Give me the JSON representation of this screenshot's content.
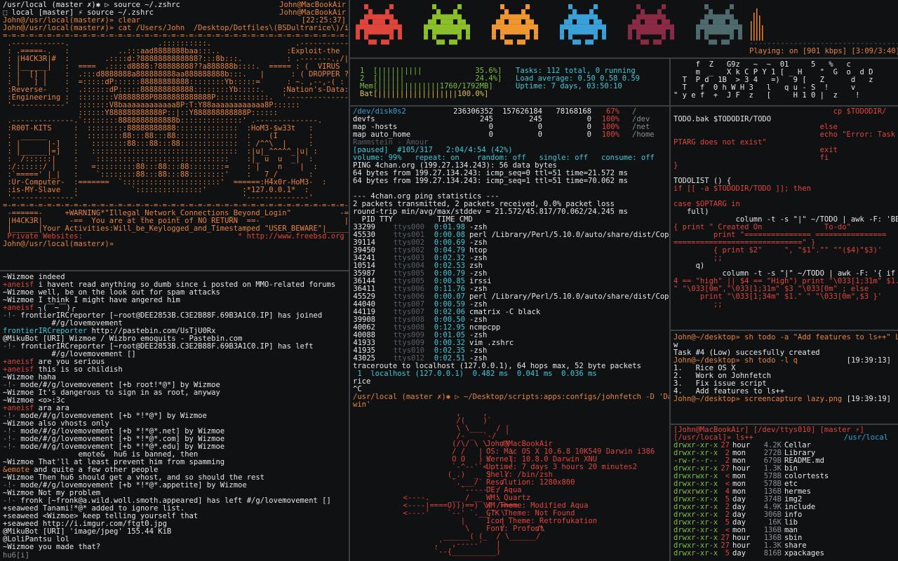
{
  "colors": {
    "red": "#e0453b",
    "green": "#8bbf2a",
    "orange": "#f0962e",
    "blue": "#3aa0d8",
    "maroon": "#8a2a45",
    "slate": "#4f6a6c"
  },
  "tl": {
    "lines": [
      "/usr/local (master ✗)✱ ▷ source ~/.zshrc",
      "⬚ local [master] ⚡ source ~/.zshrc",
      "John@/usr/local(master✗)» clear",
      "John@/usr/local(master✗)» cat /Users/John  /Desktop/Dotfiles\\(BSDultrarice\\)/issue"
    ],
    "right": [
      "John@MacBookAir",
      "John@MacBookAir",
      "[22:25:37]",
      ""
    ],
    "art": [
      "=-=-=-=-=-=-=-=-=-=-=-=-=-=-=-=-=-=-=-=-=-=-=-=-=-=-=-=-=-=-=-=-=-=-=-=-=-=-=-=-=-=-=-=-=",
      " .------------.                    .::::::::::.                   .--------------.",
      " : .=====-.   :           ..:::aad8888888baa:::..               :Exploit-the   :",
      " : |H4CK3R|#  :        .::::d:?8888888888888?:::8b:::.          : .-------.,/| :",
      " : |______|   :  ====  .::::d8888:?88888888??a888888b::::.  ===== : (  VIRUS  / :",
      " : |  [] |    :  .:::d8888888a888888888aa888888888b:::.   |      : ( DROPPER ? :",
      " : |   ] |    :  =:::::dP::::::88888888888::::::::Yb:::::=      : ~. ,--,-( :",
      " :Reverse-    :  .::::::dP:::::888888888888::::::::Yb:::::.    :Nation's-Data:",
      " :Engineering :  ::::::::V8888888P8888888888888P::::::::::::.  '--------------'",
      " '------------'  :::::::V8baaaaaaaaaaaa8P:T:Y88aaaaaaaaaaaa8P::::::",
      "                 ::::::Y888888888888P::|::Y888888888888P::::::",
      " .--------------.`::::::::8888888888888b::::::::::::::' .--------------.",
      " :R00T-KITS     :  :::::::::88888888888::::::::::::::  :HoM3-$w33t   :",
      " :  ______      :  ::::::::88:::88:::88::::::::::::::  :    (I       :",
      " : |      |-]   :   ::::::::88:::88:::88:::::::::::::  : /^^\\  |     :",
      " : |______|=]   :   :::::::::::::::::::::::::::::::::  :|u|_^^^^^_|u| :",
      " :  /::::::|    :    ::::::::::::::::::::::::::::::    :|_ u  u  _|  :",
      " :/::::::/ |    :   =:::::::::88:::88:::88::::::::=    : |    n    |  :",
      " :`=====' |_|   :    `::::::::88:::88:::88::::::::'    :   7_/       :",
      " :Ur-Computer-  :=======  `::::::::::::::::::::::'  ======:H4x0r-HoM3-  :",
      " :is-MY-Slave   :            `:::::::::::::::'        :*127.0.0.1*  :",
      " '--------------'                                     '--------------'",
      "=-=-=-=-=-=-=-=-=-=-=-=-=-=-=-=-=-=-=-=-=-=-=-=-=-=-=-=-=-=-=-=-=-=-=-=-=-=-=-=-=-=-=-=-="
    ],
    "banner": [
      " -======-     +WARNING*\"Illegal_Network_Connections_Beyond_Login\"           -======-",
      " |H4CK3R|      -==  You are at the point of NO RETURN  ==-                   |H4CK3R|",
      " |______|Your Activities:Will_be_Keylogged_and_Timestamped \"USER_BEWARE\"|______|",
      " Private Websites:                                   * http://www.freebsd.org"
    ],
    "prompt": "John@/usr/local(master✗)»"
  },
  "irc": {
    "lines": [
      [
        "~Wizmoe",
        "indeed"
      ],
      [
        "+aneisf",
        "i havent read anything so dumb since i posted on MMO-related forums"
      ],
      [
        "~Wizmoe",
        "well, be on the look out for spam attacks"
      ],
      [
        "~Wizmoe",
        "I think I might have angered him"
      ],
      [
        "+aneisf",
        "╮(￣~￣)╭"
      ],
      [
        "-!-",
        "frontierIRCreporter [~root@DEE2853B.C3E2B88F.69B3A1C0.IP] has joined"
      ],
      [
        "",
        "          #/g/lovemovement"
      ],
      [
        "frontierIRCreporter",
        "http://pastebin.com/UsTjU0Rx"
      ],
      [
        "@MikuBot",
        "[URI] Wizmoe / Wizbro emoquits - Pastebin.com"
      ],
      [
        "-!-",
        "frontierIRCreporter [~root@DEE2853B.C3E2B88F.69B3A1C0.IP] has left"
      ],
      [
        "",
        "          #/g/lovemovement []"
      ],
      [
        "+aneisf",
        "are you serious"
      ],
      [
        "+aneisf",
        "this is so childish"
      ],
      [
        "~Wizmoe",
        "haha"
      ],
      [
        "-!-",
        "mode/#/g/lovemovement [+b root!*@*] by Wizmoe"
      ],
      [
        "~Wizmoe",
        "It's dangerous to sign in as root, anyway"
      ],
      [
        "~Wizmoe",
        "<o>:3c"
      ],
      [
        "+aneisf",
        "ara ara"
      ],
      [
        "-!-",
        "mode/#/g/lovemovement [+b *!*@*] by Wizmoe"
      ],
      [
        "~Wizmoe",
        "also vhosts only"
      ],
      [
        "-!-",
        "mode/#/g/lovemovement [+b *!*@*.net] by Wizmoe"
      ],
      [
        "-!-",
        "mode/#/g/lovemovement [+b *!*@*.com] by Wizmoe"
      ],
      [
        "-!-",
        "mode/#/g/lovemovement [+b *!*@*.edu] by Wizmoe"
      ],
      [
        "",
        "                emote&  hu6 is banned, then"
      ],
      [
        "~Wizmoe",
        "That'll at least prevent him from spamming"
      ],
      [
        "&emote",
        "and quite a few other people"
      ],
      [
        "~Wizmoe",
        "Then hu6 should get a vhost, and so should the rest"
      ],
      [
        "-!-",
        "mode/#/g/lovemovement [+b *!*@*.appetite] by Wizmoe"
      ],
      [
        "~Wizmoe",
        "Not my problem"
      ],
      [
        "-!-",
        "fronk [~fronk@a.wild.woll.smoth.appeared] has left #/g/lovemovement []"
      ],
      [
        "+seaweed",
        "Tanami!*@* added to ignore list."
      ],
      [
        "+seaweed",
        "<Wizmoe> keep telling yourself that"
      ],
      [
        "+seaweed",
        "http://i.imgur.com/ftgt0.jpg"
      ],
      [
        "@MikuBot",
        "[URI] 'image/jpeg' 155.44 KiB"
      ],
      [
        "@LoliPantsu",
        "lol"
      ],
      [
        "~Wizmoe",
        "you made that?"
      ]
    ],
    "input": "hu6[i]"
  },
  "top_right": {
    "music": "Playing: on [901 kbps] [3:09/3:40]",
    "dashes": "-------------------------------------___"
  },
  "htop": {
    "cpu1": "1  [||||||||||            35.6%]",
    "cpu2": "2  [||||||                24.4%]",
    "mem": "Mem[||||||||||||||1760/1792MB]",
    "bat": "Bat[||||||||||||||||||100.0%]",
    "tasks": "Tasks: 112 total, 0 running",
    "load": "Load average: 0.50 0.58 0.59",
    "uptime": "Uptime: 7 days, 03:50:10"
  },
  "matrix": [
    "     f  Z   G9z   ~  ~  01     5   %   c",
    "     m  _   X k C P Y 1 [ _ H    \"  G  o  d D",
    "  T  P d  1B  > 3 4   =)   9 [   Z      d   z",
    "  T   f  0 h W H 3   l   q u - S  !     v",
    "\" y e f  +  J F  z   [     H 1 0 |  z    !"
  ],
  "df": {
    "rows": [
      [
        "/dev/disk0s2",
        "236306352",
        "157626184",
        "78168168",
        "67%",
        "/"
      ],
      [
        "devfs",
        "245",
        "245",
        "0",
        "100%",
        "/dev"
      ],
      [
        "map -hosts",
        "0",
        "0",
        "0",
        "100%",
        "/net"
      ],
      [
        "map auto_home",
        "0",
        "0",
        "0",
        "100%",
        "/home"
      ]
    ],
    "song": "Rammstein - Amour",
    "paused": "[paused]  #105/317   2:04/4:54 (42%)",
    "opts": "volume: 99%   repeat: on    random: off   single: off   consume: off"
  },
  "ping": [
    "PING 4chan.org (199.27.134.243): 56 data bytes",
    "64 bytes from 199.27.134.243: icmp_seq=0 ttl=51 time=21.572 ms",
    "64 bytes from 199.27.134.243: icmp_seq=1 ttl=51 time=70.062 ms",
    "",
    "--- 4chan.org ping statistics ---",
    "2 packets transmitted, 2 packets received, 0.0% packet loss",
    "round-trip min/avg/max/stddev = 21.572/45.817/70.062/24.245 ms"
  ],
  "ps": {
    "header": "  PID TTY          TIME CMD",
    "rows": [
      [
        "33299",
        "ttys000",
        "0:01.98",
        "-zsh"
      ],
      [
        "45530",
        "ttys001",
        "0:00.08",
        "perl /Library/Perl/5.10.0/auto/share/dist/Cope/p"
      ],
      [
        "39114",
        "ttys002",
        "0:00.69",
        "-zsh"
      ],
      [
        "39450",
        "ttys002",
        "0:04.79",
        "htop"
      ],
      [
        "34241",
        "ttys003",
        "0:02.32",
        "-zsh"
      ],
      [
        "10514",
        "ttys004",
        "0:02.53",
        "zsh"
      ],
      [
        "35987",
        "ttys005",
        "0:00.79",
        "-zsh"
      ],
      [
        "36144",
        "ttys005",
        "0:00.85",
        "irssi"
      ],
      [
        "36411",
        "ttys006",
        "0:11.76",
        "-zsh"
      ],
      [
        "45529",
        "ttys006",
        "0:00.07",
        "perl /Library/Perl/5.10.0/auto/share/dist/Cope//"
      ],
      [
        "44040",
        "ttys007",
        "0:00.59",
        "-zsh"
      ],
      [
        "44119",
        "ttys007",
        "0:02.06",
        "cmatrix -C black"
      ],
      [
        "39908",
        "ttys008",
        "0:00.50",
        "-zsh"
      ],
      [
        "40062",
        "ttys008",
        "0:12.95",
        "ncmpcpp"
      ],
      [
        "40088",
        "ttys009",
        "0:01.05",
        "-zsh"
      ],
      [
        "41933",
        "ttys009",
        "0:00.32",
        "vim .zshrc"
      ],
      [
        "41935",
        "ttys010",
        "0:02.35",
        "-zsh"
      ],
      [
        "43025",
        "ttys012",
        "0:02.51",
        "-zsh"
      ]
    ],
    "trace": "traceroute to localhost (127.0.0.1), 64 hops max, 52 byte packets",
    "trace1": " 1  localhost (127.0.0.1)  0.482 ms  0.041 ms  0.036 ms",
    "rice": "rice",
    "ctrl": "^C",
    "prompt": "/usr/local (master ✗)✱ ▷ ~/Desktop/scripts:apps:configs/johnfetch -D 'Dar",
    "prompt2": "win'"
  },
  "fetch": [
    [
      "",
      "John@MacBookAir"
    ],
    [
      "OS:",
      "Mac OS X 10.6.8 10K549 Darwin i386"
    ],
    [
      "Kernel:",
      "10.8.0 Darwin XNU"
    ],
    [
      "Uptime:",
      "7 days 3 hours 20 minutes2"
    ],
    [
      "Shell:",
      "/bin/zsh"
    ],
    [
      "Resolution:",
      "1280x800"
    ],
    [
      "DE:",
      "Aqua"
    ],
    [
      "WM:",
      "Quartz"
    ],
    [
      "WM Theme:",
      "Modified Aqua"
    ],
    [
      "GTK Theme:",
      "Not Found"
    ],
    [
      "Icon Theme:",
      "Retrofukation"
    ],
    [
      "Font:",
      "Profont"
    ]
  ],
  "vim": {
    "lines": [
      [
        "",
        "                                    cp $TODODIR/"
      ],
      [
        "",
        "TODO.bak $TODODIR/TODO"
      ],
      [
        "",
        "                                 else"
      ],
      [
        "",
        "                                 echo \"Error: Task $O"
      ],
      [
        "",
        "PTARG does not exist\""
      ],
      [
        "",
        "                                 exit"
      ],
      [
        "",
        "                                 fi"
      ],
      [
        "",
        "}"
      ],
      [
        "",
        ""
      ],
      [
        "",
        "TODOLIST () {"
      ],
      [
        "",
        "if [[ -a $TODODIR/TODO ]]; then"
      ],
      [
        "",
        ""
      ],
      [
        "",
        "case $OPTARG in"
      ],
      [
        "",
        "   full)"
      ],
      [
        "",
        "              column -t -s \"|\" ~/TODO | awk -F: 'BEGIN"
      ],
      [
        "",
        "{ print \" Created On              To-do\""
      ],
      [
        "",
        "         print \"=============== ================"
      ],
      [
        "",
        "=============================\" }"
      ],
      [
        "",
        "         { print $2\"     \", \"$1\".\"\" \"\"($4)\"$3)'"
      ],
      [
        "",
        "         ;;"
      ],
      [
        "",
        "     q)"
      ],
      [
        "",
        "           column -t -s \"|\" ~/TODO | awk -F: '{ if ( $"
      ],
      [
        "",
        "4 == \"high\" || $4 == \"High\") print \"\\033[1;31m\" $1."
      ],
      [
        "",
        "\" \"\\033[0m\",\"\\033[1;31m\" $3 \"\\033[0m\" ; else"
      ],
      [
        "",
        "      print \"\\033[1;34m\" $1.\" \" \"\\033[0m\",$3 }'"
      ],
      [
        "",
        "         ;;"
      ]
    ]
  },
  "todo": {
    "lines": [
      [
        "John@~/desktop» sh todo -a \"Add features to ls++\" Lo",
        ""
      ],
      [
        "w",
        ""
      ],
      [
        "Task #4 (Low) succesfully created",
        ""
      ],
      [
        "John@~/desktop» sh todo -l q",
        "[19:39:13]"
      ],
      [
        "1.   Rice OS X",
        ""
      ],
      [
        "2.   Work on Johnfetch",
        ""
      ],
      [
        "3.   Fix issue script",
        ""
      ],
      [
        "4.   Add features to ls++",
        ""
      ],
      [
        "John@~/desktop» screencapture lazy.png",
        "[19:39:19]"
      ]
    ]
  },
  "ls": {
    "header": "[John@MacBookAir] [/dev/ttys010] [master ⚡]",
    "prompt": "[/usr/local]» ls++",
    "path": "/usr/local",
    "rows": [
      [
        "drwxr-xr-x",
        "27",
        "hour",
        "4.2K",
        "Cellar"
      ],
      [
        "drwxr-xr-x",
        "2",
        "mon",
        "272B",
        "Library"
      ],
      [
        "-rw-r--r--",
        "2",
        "mon",
        "679B",
        "README.md"
      ],
      [
        "drwxr-xr-x",
        "27",
        "hour",
        "1.3K",
        "bin"
      ],
      [
        "drwxrwxr-x",
        "<",
        "mon",
        "578B",
        "colortests"
      ],
      [
        "drwxr-xr-x",
        "<",
        "mon",
        "578B",
        "etc"
      ],
      [
        "drwxrwxr-x",
        "4",
        "mon",
        "136B",
        "hermes"
      ],
      [
        "drwxr-xr-x",
        "5",
        "day",
        "374B",
        "img2"
      ],
      [
        "drwxr-xr-x",
        "2",
        "day",
        "4.9K",
        "include"
      ],
      [
        "drwxr-xr-x",
        "2",
        "day",
        "306B",
        "info"
      ],
      [
        "drwxr-xr-x",
        "5",
        "day",
        "16K",
        "lib"
      ],
      [
        "drwxr-xr-x",
        "<",
        "mon",
        "136B",
        "man"
      ],
      [
        "drwxr-xr-x",
        "27",
        "hour",
        "136B",
        "sbin"
      ],
      [
        "drwxr-xr-x",
        "27",
        "hour",
        "1.3K",
        "share"
      ],
      [
        "drwxr-xr-x",
        "5",
        "day",
        "816B",
        "xpackages"
      ]
    ]
  }
}
